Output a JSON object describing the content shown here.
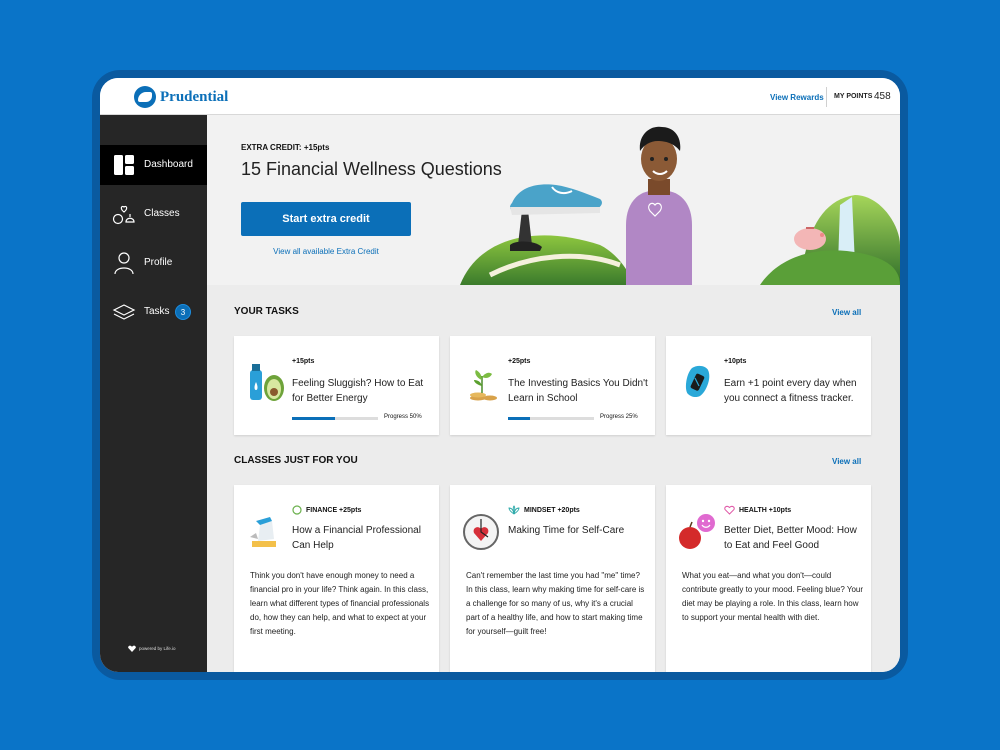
{
  "topbar": {
    "brand": "Prudential",
    "view_rewards": "View Rewards",
    "points_label": "MY POINTS",
    "points_value": "458"
  },
  "sidebar": {
    "items": [
      {
        "label": "Dashboard",
        "icon": "dashboard-icon",
        "active": true
      },
      {
        "label": "Classes",
        "icon": "classes-icon"
      },
      {
        "label": "Profile",
        "icon": "profile-icon"
      },
      {
        "label": "Tasks",
        "icon": "tasks-icon",
        "badge": "3"
      }
    ],
    "powered_by": "powered by Life.io"
  },
  "hero": {
    "tag": "EXTRA CREDIT: +15pts",
    "title": "15 Financial Wellness Questions",
    "button": "Start extra credit",
    "link": "View all available Extra Credit"
  },
  "tasks": {
    "title": "YOUR TASKS",
    "view_all": "View all",
    "items": [
      {
        "points": "+15pts",
        "title": "Feeling Sluggish? How to Eat for Better Energy",
        "progress_label": "Progress 50%",
        "progress": 0.5
      },
      {
        "points": "+25pts",
        "title": "The Investing Basics You Didn't Learn in School",
        "progress_label": "Progress 25%",
        "progress": 0.25
      },
      {
        "points": "+10pts",
        "title": "Earn +1 point every day when you connect a fitness tracker."
      }
    ]
  },
  "classes": {
    "title": "CLASSES JUST FOR YOU",
    "view_all": "View all",
    "items": [
      {
        "category": "FINANCE +25pts",
        "title": "How a Financial Professional Can Help",
        "description": "Think you don't have enough money to need a financial pro in your life? Think again. In this class, learn what different types of financial professionals do, how they can help, and what to expect at your first meeting."
      },
      {
        "category": "MINDSET +20pts",
        "title": "Making Time for Self-Care",
        "description": "Can't remember the last time you had \"me\" time? In this class, learn why making time for self-care is a challenge for so many of us, why it's a crucial part of a healthy life, and how to start making time for yourself—guilt free!"
      },
      {
        "category": "HEALTH +10pts",
        "title": "Better Diet, Better Mood: How to Eat and Feel Good",
        "description": "What you eat—and what you don't—could contribute greatly to your mood. Feeling blue? Your diet may be playing a role. In this class, learn how to support your mental health with diet."
      }
    ]
  },
  "colors": {
    "primary": "#0b6fb8",
    "sidebar": "#262626",
    "background": "#0a74c8"
  }
}
